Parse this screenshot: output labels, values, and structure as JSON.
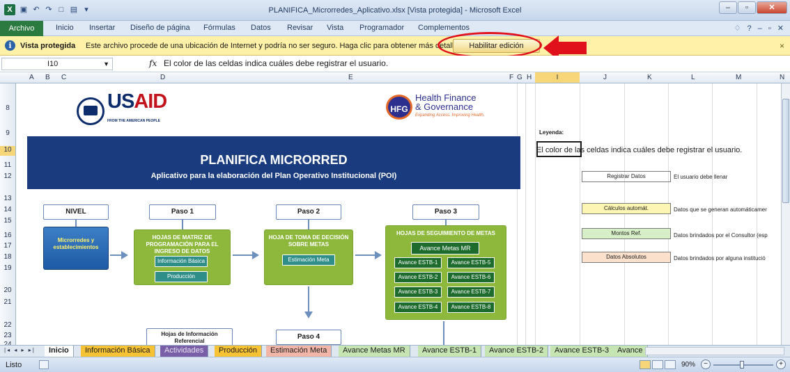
{
  "window": {
    "title": "PLANIFICA_Microrredes_Aplicativo.xlsx  [Vista protegida]  -  Microsoft Excel"
  },
  "menu": {
    "file": "Archivo",
    "tabs": [
      "Inicio",
      "Insertar",
      "Diseño de página",
      "Fórmulas",
      "Datos",
      "Revisar",
      "Vista",
      "Programador",
      "Complementos"
    ]
  },
  "protected_view": {
    "label": "Vista protegida",
    "message": "Este archivo procede de una ubicación de Internet y podría no ser seguro. Haga clic para obtener más detalles.",
    "enable_button": "Habilitar edición",
    "close": "×"
  },
  "formula_bar": {
    "cell_ref": "I10",
    "fx": "fx",
    "content": "El color de las celdas indica cuáles debe registrar el usuario."
  },
  "columns": [
    "A",
    "B",
    "C",
    "D",
    "E",
    "F",
    "G",
    "H",
    "I",
    "J",
    "K",
    "L",
    "M",
    "N"
  ],
  "rows": [
    "8",
    "9",
    "10",
    "11",
    "12",
    "13",
    "14",
    "15",
    "16",
    "17",
    "18",
    "19",
    "20",
    "21",
    "22",
    "23",
    "24"
  ],
  "banner": {
    "usaid_word_a": "US",
    "usaid_word_b": "AID",
    "usaid_tagline": "FROM THE AMERICAN PEOPLE",
    "hfg_logo": "HFG",
    "hfg_line1": "Health Finance",
    "hfg_line2": "& Governance",
    "hfg_tagline": "Expanding Access. Improving Health.",
    "title": "PLANIFICA MICRORRED",
    "subtitle": "Aplicativo para la elaboración del Plan Operativo Institucional (POI)"
  },
  "flow": {
    "nivel": "NIVEL",
    "paso1": "Paso 1",
    "paso2": "Paso 2",
    "paso3": "Paso 3",
    "paso4": "Paso 4",
    "nivel_box": "Microrredes y establecimientos",
    "paso1_box": "HOJAS DE MATRIZ DE PROGRAMACIÓN PARA EL INGRESO DE DATOS",
    "paso1_btn1": "Información Básica",
    "paso1_btn2": "Producción",
    "paso2_box": "HOJA DE TOMA DE DECISIÓN SOBRE METAS",
    "paso2_btn": "Estimación Meta",
    "paso3_box": "HOJAS DE SEGUIMIENTO DE METAS",
    "paso3_main": "Avance Metas MR",
    "paso3_btns": [
      "Avance ESTB-1",
      "Avance ESTB-5",
      "Avance ESTB-2",
      "Avance ESTB-6",
      "Avance ESTB-3",
      "Avance ESTB-7",
      "Avance ESTB-4",
      "Avance ESTB-8"
    ],
    "info_box": "Hojas de Información Referencial"
  },
  "legend": {
    "title": "Leyenda:",
    "intro": "El color de las celdas indica cuáles debe registrar el usuario.",
    "items": [
      {
        "label": "Registrar Datos",
        "desc": "El usuario debe llenar",
        "color": "#ffffff"
      },
      {
        "label": "Cálculos automát.",
        "desc": "Datos que se generan automáticamer",
        "color": "#fdf5b3"
      },
      {
        "label": "Montos Ref.",
        "desc": "Datos brindados por el Consultor (esp",
        "color": "#d7efc6"
      },
      {
        "label": "Datos Absolutos",
        "desc": "Datos brindados por alguna institució",
        "color": "#fbe0cc"
      }
    ]
  },
  "sheet_tabs": [
    {
      "name": "Inicio",
      "color": "#ffffff"
    },
    {
      "name": "Información Básica",
      "color": "#f7c234"
    },
    {
      "name": "Actividades",
      "color": "#7a5fa8"
    },
    {
      "name": "Producción",
      "color": "#f7c234"
    },
    {
      "name": "Estimación Meta",
      "color": "#f2b6a8"
    },
    {
      "name": "Avance Metas MR",
      "color": "#c6e5b3"
    },
    {
      "name": "Avance ESTB-1",
      "color": "#c6e5b3"
    },
    {
      "name": "Avance ESTB-2",
      "color": "#c6e5b3"
    },
    {
      "name": "Avance ESTB-3",
      "color": "#c6e5b3"
    },
    {
      "name": "Avance",
      "color": "#c6e5b3"
    }
  ],
  "status": {
    "ready": "Listo",
    "zoom": "90%",
    "minus": "−",
    "plus": "+"
  }
}
